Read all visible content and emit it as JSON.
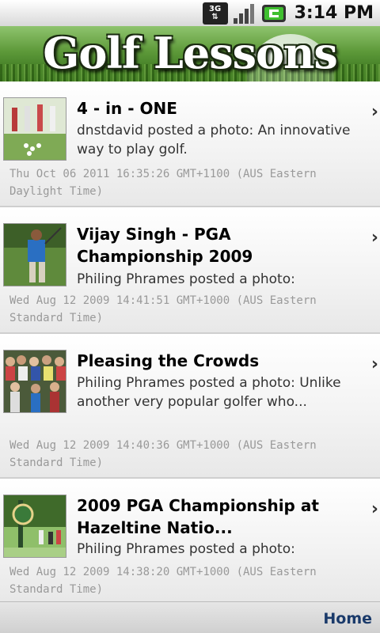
{
  "status_bar": {
    "network_label": "3G",
    "time": "3:14 PM",
    "network_icon": "3g-arrows-icon",
    "signal_icon": "signal-bars-icon",
    "battery_icon": "battery-icon"
  },
  "header": {
    "title": "Golf Lessons"
  },
  "posts": [
    {
      "title": "4 - in - ONE",
      "description": "dnstdavid posted a photo: An innovative way to play golf.",
      "date": "Thu Oct 06 2011 16:35:26 GMT+1100 (AUS Eastern Daylight Time)"
    },
    {
      "title": "Vijay Singh - PGA Championship 2009",
      "description": "Philing Phrames posted a photo:",
      "date": "Wed Aug 12 2009 14:41:51 GMT+1000 (AUS Eastern Standard Time)"
    },
    {
      "title": "Pleasing the Crowds",
      "description": "Philing Phrames posted a photo: Unlike another very popular golfer who...",
      "date": "Wed Aug 12 2009 14:40:36 GMT+1000 (AUS Eastern Standard Time)"
    },
    {
      "title": "2009 PGA Championship at Hazeltine Natio...",
      "description": "Philing Phrames posted a photo:",
      "date": "Wed Aug 12 2009 14:38:20 GMT+1000 (AUS Eastern Standard Time)"
    }
  ],
  "chevron_glyph": "›",
  "footer": {
    "home_label": "Home"
  },
  "colors": {
    "banner_green": "#5e9a3a",
    "link_blue": "#1a3a6a"
  }
}
